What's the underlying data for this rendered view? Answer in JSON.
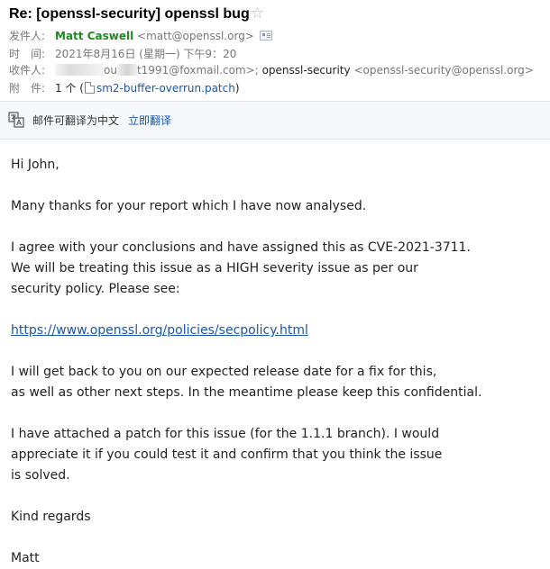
{
  "email": {
    "subject": "Re: [openssl-security] openssl bug",
    "star_glyph": "☆",
    "from": {
      "label": "发件人:",
      "name": "Matt Caswell",
      "address": "<matt@openssl.org>"
    },
    "time": {
      "label": "时　间:",
      "value": "2021年8月16日 (星期一) 下午9：20"
    },
    "to": {
      "label": "收件人:",
      "recipient1_visible_a": "ou",
      "recipient1_visible_b": "t1991@foxmail.com>;",
      "recipient2_name": "openssl-security",
      "recipient2_address": "<openssl-security@openssl.org>"
    },
    "attachment": {
      "label": "附　件:",
      "count": "1 个 (",
      "filename": "sm2-buffer-overrun.patch",
      "close": ")"
    }
  },
  "translate": {
    "label": "邮件可翻译为中文",
    "action": "立即翻译"
  },
  "body": {
    "greeting": "Hi John,",
    "p1": "Many thanks for your report which I have now analysed.",
    "p2_l1": "I agree with your conclusions and have assigned this as CVE-2021-3711.",
    "p2_l2": "We will be treating this issue as a HIGH severity issue as per our",
    "p2_l3": "security policy. Please see:",
    "link": "https://www.openssl.org/policies/secpolicy.html",
    "p3_l1": "I will get back to you on our expected release date for a fix for this,",
    "p3_l2": "as well as other next steps. In the meantime please keep this confidential.",
    "p4_l1": "I have attached a patch for this issue (for the 1.1.1 branch). I would",
    "p4_l2": "appreciate it if you could test it and confirm that you think the issue",
    "p4_l3": "is solved.",
    "signoff": "Kind regards",
    "signature": "Matt"
  }
}
